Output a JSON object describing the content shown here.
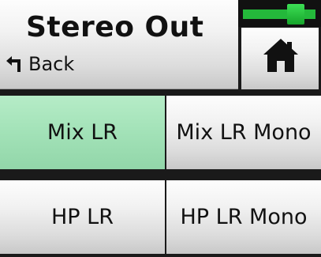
{
  "header": {
    "title": "Stereo Out",
    "back_label": "Back"
  },
  "meter": {
    "level": 0.8,
    "color": "#24b93b"
  },
  "home": {
    "icon": "home-icon"
  },
  "options": [
    {
      "label": "Mix LR",
      "selected": true
    },
    {
      "label": "Mix LR Mono",
      "selected": false
    },
    {
      "label": "HP LR",
      "selected": false
    },
    {
      "label": "HP LR Mono",
      "selected": false
    }
  ],
  "colors": {
    "selected": "#a4e3b9",
    "background": "#1a1a1a"
  }
}
